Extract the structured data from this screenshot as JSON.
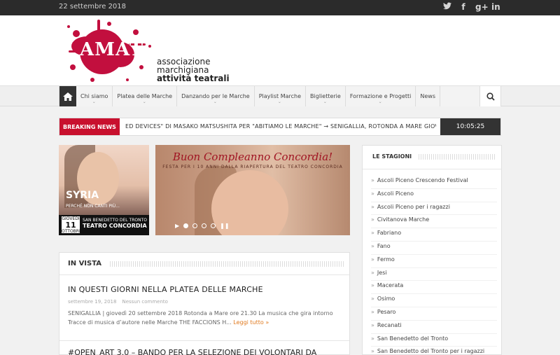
{
  "topbar": {
    "date": "22 settembre 2018",
    "social": [
      {
        "icon": "twitter-icon",
        "glyph": "🐦"
      },
      {
        "icon": "facebook-icon",
        "glyph": "f"
      },
      {
        "icon": "googleplus-icon",
        "glyph": "g+"
      },
      {
        "icon": "linkedin-icon",
        "glyph": "in"
      }
    ]
  },
  "logo": {
    "text": "AMAT",
    "tagline": [
      "associazione",
      "marchigiana",
      "attività teatrali"
    ],
    "brand_color": "#c20f3e"
  },
  "nav": {
    "items": [
      "Chi siamo",
      "Platea delle Marche",
      "Danzando per le Marche",
      "Playlist Marche",
      "Biglietterie",
      "Formazione e Progetti",
      "News"
    ]
  },
  "breaking": {
    "label": "BREAKING NEWS",
    "ticker": "ED DEVICES\" DI MASAKO MATSUSHITA PER \"ABITIAMO LE MARCHE\"   →   SENIGALLIA, ROTONDA A MARE GIOV",
    "clock": "10:05:25",
    "accent": "#c8102e"
  },
  "poster": {
    "title": "SYRIA",
    "subtitle": "PERCHÉ NON CANTI PIÙ...",
    "day_label": "GIOVEDÌ",
    "day_number": "11",
    "month": "OTTOBRE",
    "city": "SAN BENEDETTO DEL TRONTO",
    "venue": "TEATRO CONCORDIA"
  },
  "slide": {
    "title": "Buon Compleanno Concordia!",
    "subtitle": "FESTA PER I 10 ANNI DALLA RIAPERTURA DEL TEATRO CONCORDIA"
  },
  "vista": {
    "heading": "IN VISTA",
    "post1": {
      "title": "IN QUESTI GIORNI NELLA PLATEA DELLE MARCHE",
      "date": "settembre 19, 2018",
      "comments": "Nessun commento",
      "excerpt": "SENIGALLIA | giovedì 20 settembre 2018 Rotonda a Mare ore 21.30 La musica che gira intorno Tracce di musica d’autore nelle Marche THE FACCIONS H...",
      "more": "Leggi tutto »"
    },
    "post2_title": "#OPEN_ART 3.0 – BANDO PER LA SELEZIONE DEI VOLONTARI DA"
  },
  "stagioni": {
    "heading": "LE STAGIONI",
    "items": [
      "Ascoli Piceno Crescendo Festival",
      "Ascoli Piceno",
      "Ascoli Piceno per i ragazzi",
      "Civitanova Marche",
      "Fabriano",
      "Fano",
      "Fermo",
      "Jesi",
      "Macerata",
      "Osimo",
      "Pesaro",
      "Recanati",
      "San Benedetto del Tronto",
      "San Benedetto del Tronto per i ragazzi"
    ]
  }
}
